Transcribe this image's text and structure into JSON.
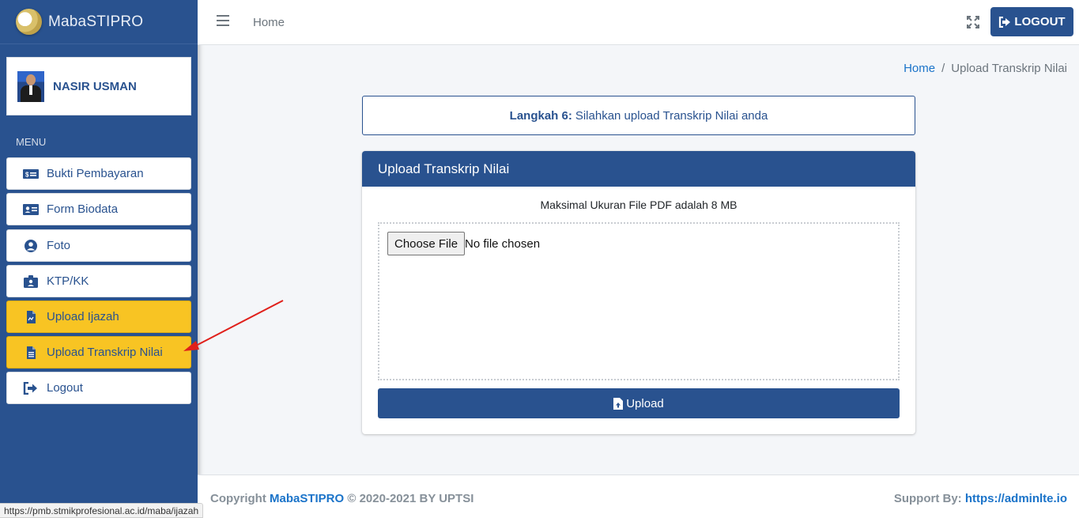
{
  "brand": {
    "name": "MabaSTIPRO"
  },
  "user": {
    "name": "NASIR USMAN"
  },
  "sidebar": {
    "menu_header": "MENU",
    "items": [
      {
        "label": "Bukti Pembayaran",
        "icon": "money-bill-icon"
      },
      {
        "label": "Form Biodata",
        "icon": "id-card-icon"
      },
      {
        "label": "Foto",
        "icon": "user-circle-icon"
      },
      {
        "label": "KTP/KK",
        "icon": "id-badge-icon"
      },
      {
        "label": "Upload Ijazah",
        "icon": "file-pdf-icon"
      },
      {
        "label": "Upload Transkrip Nilai",
        "icon": "file-alt-icon"
      },
      {
        "label": "Logout",
        "icon": "sign-out-icon"
      }
    ],
    "active_color": "#f8c423"
  },
  "navbar": {
    "home": "Home",
    "logout": "LOGOUT"
  },
  "breadcrumb": {
    "home": "Home",
    "separator": "/",
    "current": "Upload Transkrip Nilai"
  },
  "step": {
    "label": "Langkah 6:",
    "text": "Silahkan upload Transkrip Nilai anda"
  },
  "card": {
    "title": "Upload Transkrip Nilai",
    "note": "Maksimal Ukuran File PDF adalah 8 MB",
    "file_button": "Choose File",
    "file_status": "No file chosen",
    "upload": "Upload"
  },
  "footer": {
    "copyright_prefix": "Copyright",
    "brand_link": "MabaSTIPRO",
    "copyright_suffix": "© 2020-2021 BY UPTSI",
    "support_label": "Support By:",
    "support_link": "https://adminlte.io"
  },
  "statusbar": {
    "url": "https://pmb.stmikprofesional.ac.id/maba/ijazah"
  },
  "colors": {
    "primary": "#29528f",
    "accent": "#f8c423",
    "link": "#1a73c9",
    "annotation": "#e0201b"
  }
}
